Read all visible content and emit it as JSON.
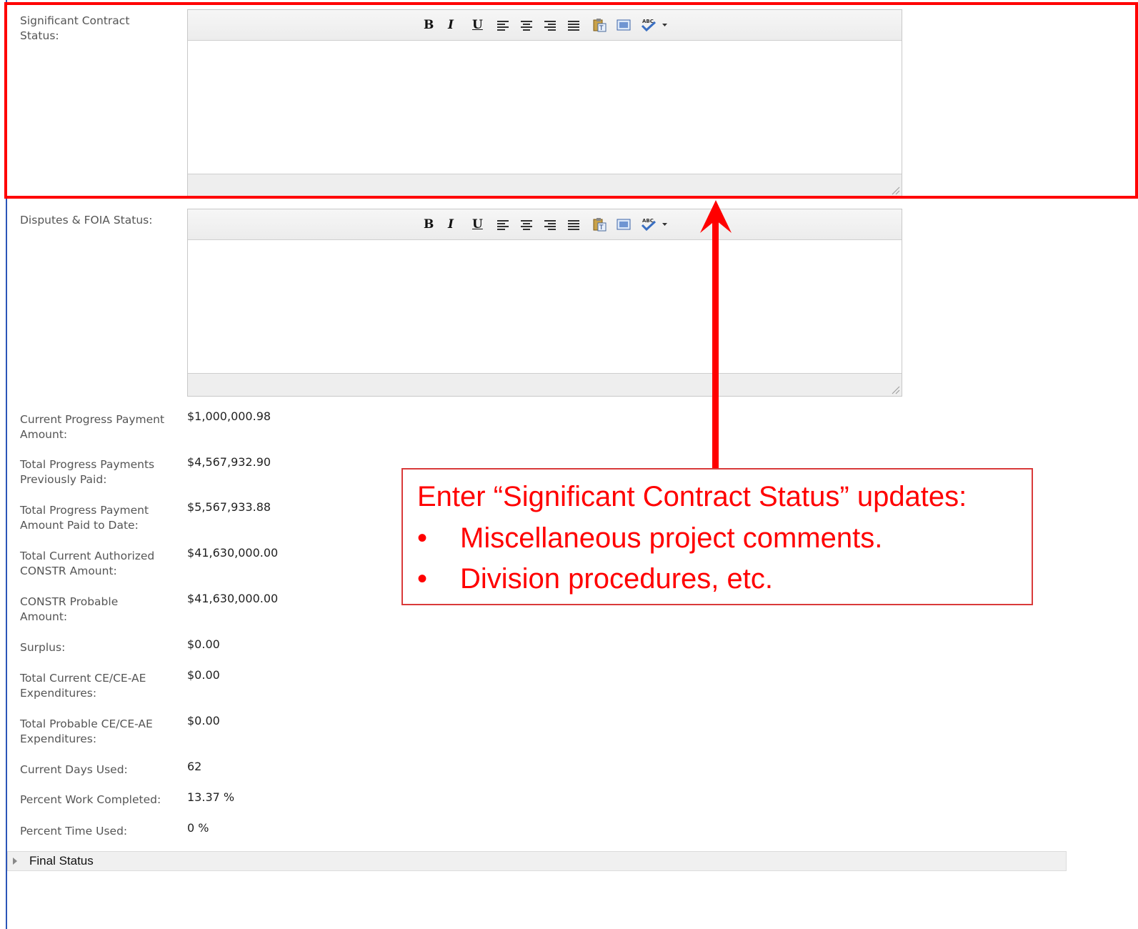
{
  "fields": {
    "significant_contract_status_label": "Significant Contract Status:",
    "disputes_foia_status_label": "Disputes & FOIA Status:"
  },
  "editor": {
    "bold": "B",
    "italic": "I",
    "underline": "U",
    "icons": [
      "bold-icon",
      "italic-icon",
      "underline-icon",
      "align-left-icon",
      "align-center-icon",
      "align-right-icon",
      "align-justify-icon",
      "paste-text-icon",
      "select-all-icon",
      "spellcheck-icon",
      "dropdown-arrow-icon"
    ]
  },
  "summary": [
    {
      "label": "Current Progress Payment Amount:",
      "value": "$1,000,000.98"
    },
    {
      "label": "Total Progress Payments Previously Paid:",
      "value": "$4,567,932.90"
    },
    {
      "label": "Total Progress Payment Amount Paid to Date:",
      "value": "$5,567,933.88"
    },
    {
      "label": "Total Current Authorized CONSTR Amount:",
      "value": "$41,630,000.00"
    },
    {
      "label": "CONSTR Probable Amount:",
      "value": "$41,630,000.00"
    },
    {
      "label": "Surplus:",
      "value": "$0.00"
    },
    {
      "label": "Total Current CE/CE-AE Expenditures:",
      "value": "$0.00"
    },
    {
      "label": "Total Probable CE/CE-AE Expenditures:",
      "value": "$0.00"
    },
    {
      "label": "Current Days Used:",
      "value": "62"
    },
    {
      "label": "Percent Work Completed:",
      "value": "13.37 %"
    },
    {
      "label": "Percent Time Used:",
      "value": "0 %"
    }
  ],
  "final_status": {
    "label": "Final Status"
  },
  "callout": {
    "title": "Enter “Significant Contract Status” updates:",
    "bullet_symbol": "•",
    "bullets": [
      "Miscellaneous project comments.",
      "Division procedures, etc."
    ]
  },
  "colors": {
    "annotation": "#ff0000",
    "left_rule": "#2b55b8"
  }
}
